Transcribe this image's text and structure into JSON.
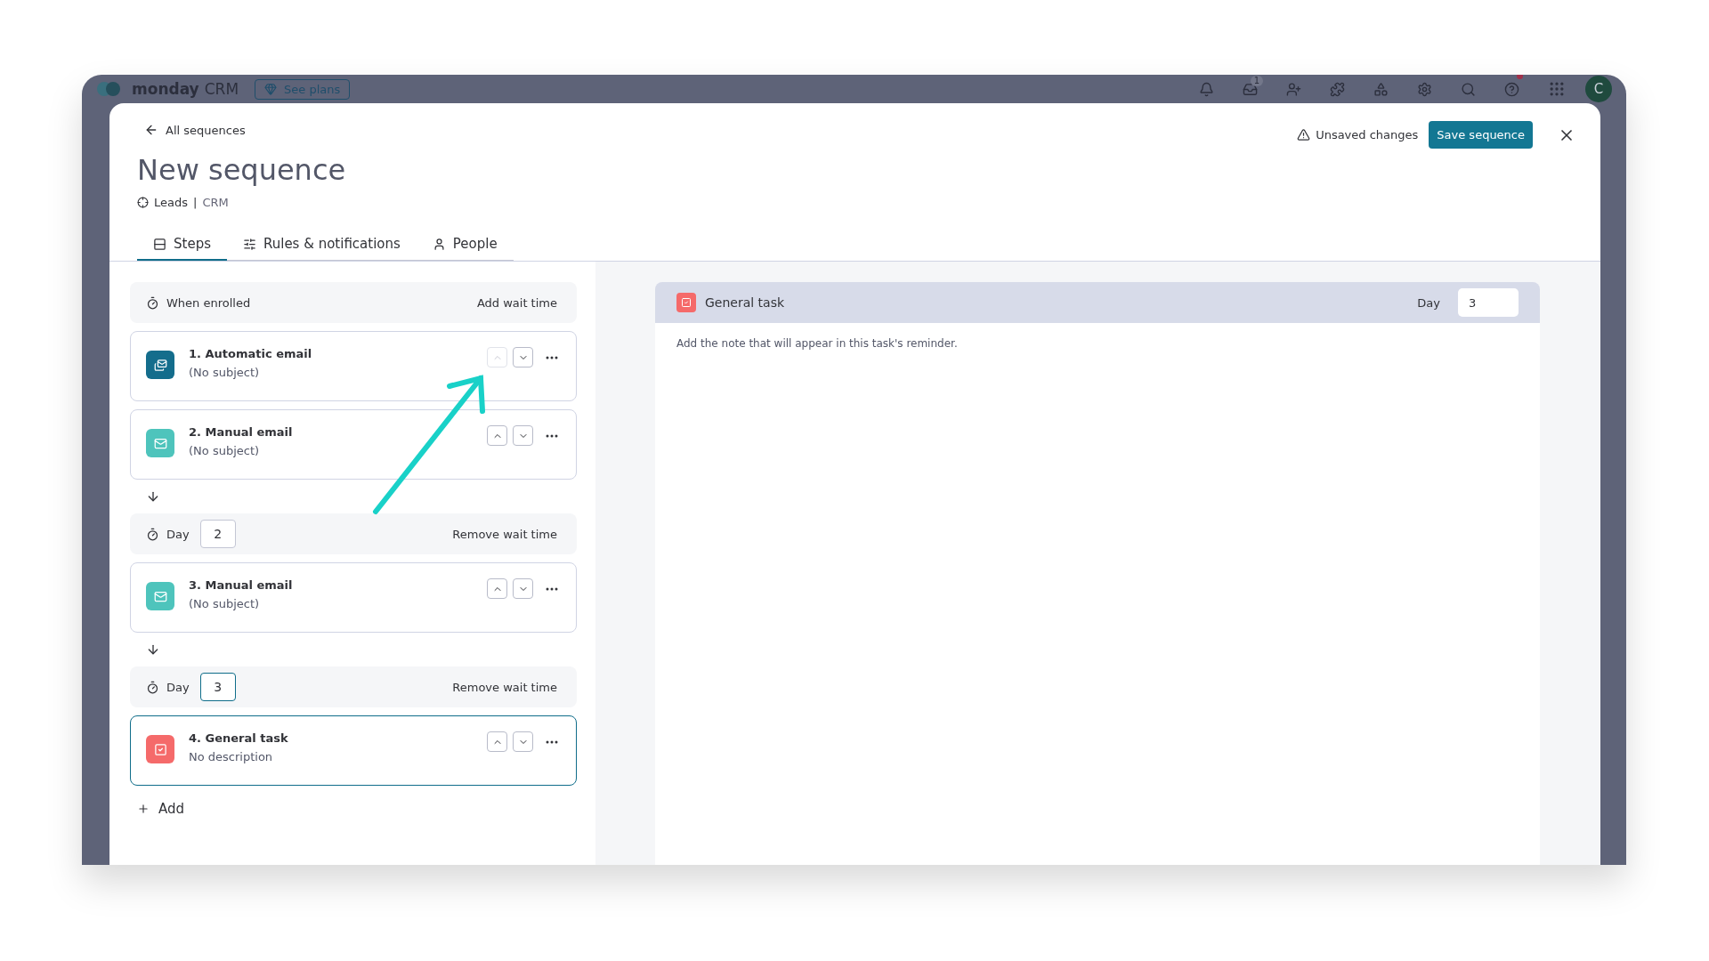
{
  "app_bar": {
    "logo_bold": "monday",
    "logo_light": "CRM",
    "plans_button": "See plans",
    "inbox_badge": "1",
    "help_notification": true,
    "avatar": "C"
  },
  "modal": {
    "back_link": "All sequences",
    "title": "New sequence",
    "board": "Leads",
    "separator": "|",
    "workspace": "CRM",
    "unsaved_notice": "Unsaved changes",
    "save_button": "Save sequence",
    "tabs": [
      {
        "label": "Steps",
        "selected": true
      },
      {
        "label": "Rules & notifications",
        "selected": false
      },
      {
        "label": "People",
        "selected": false
      }
    ]
  },
  "steps": [
    {
      "kind": "start",
      "label": "When enrolled",
      "action": "Add wait time"
    },
    {
      "kind": "automatic_email",
      "title": "1. Automatic email",
      "subtitle": "(No subject)",
      "move_up_disabled": true,
      "selected": false
    },
    {
      "kind": "manual_email",
      "title": "2. Manual email",
      "subtitle": "(No subject)",
      "move_up_disabled": false,
      "selected": false
    },
    {
      "kind": "arrow"
    },
    {
      "kind": "wait",
      "label": "Day",
      "day": "2",
      "focused": false,
      "action": "Remove wait time"
    },
    {
      "kind": "manual_email",
      "title": "3. Manual email",
      "subtitle": "(No subject)",
      "move_up_disabled": false,
      "selected": false
    },
    {
      "kind": "arrow"
    },
    {
      "kind": "wait",
      "label": "Day",
      "day": "3",
      "focused": true,
      "action": "Remove wait time"
    },
    {
      "kind": "task",
      "title": "4. General task",
      "subtitle": "No description",
      "move_up_disabled": false,
      "selected": true
    }
  ],
  "add_button": "Add",
  "detail": {
    "title": "General task",
    "day_label": "Day",
    "day": "3",
    "note_placeholder": "Add the note that will appear in this task's reminder."
  }
}
